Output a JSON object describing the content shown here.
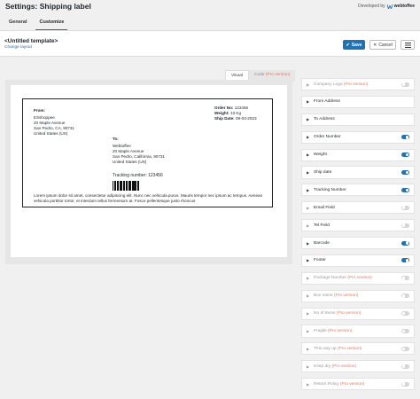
{
  "header": {
    "title": "Settings: Shipping label",
    "developed_by": "Developed by",
    "brand": "webtoffee"
  },
  "tabs": [
    {
      "label": "General",
      "active": false
    },
    {
      "label": "Customize",
      "active": true
    }
  ],
  "template": {
    "name": "<Untitled template>",
    "change_layout": "Change layout"
  },
  "actions": {
    "save": "Save",
    "cancel": "Cancel"
  },
  "view_tabs": {
    "visual": "Visual",
    "code": "Code",
    "code_pro": "(Pro version)"
  },
  "label": {
    "from_heading": "From:",
    "from_lines": [
      "ESshoppee",
      "20 Maple Avenue",
      "San Pedro, CA, 90731",
      "United States (US)"
    ],
    "order_number_label": "Order No:",
    "order_number": "123456",
    "weight_label": "Weight:",
    "weight": "10 Kg",
    "ship_date_label": "Ship Date:",
    "ship_date": "09-03-2023",
    "to_heading": "To:",
    "to_lines": [
      "Webtoffee",
      "20 Maple Avenue",
      "San Pedro, California, 90731",
      "United States (US)"
    ],
    "tracking": "Tracking number: 123456",
    "footer_text": "Lorem ipsum dolor sit amet, consectetur adipiscing elit. Nunc nec vehicula purus. Mauris tempor nec ipsum ac tempus. Aenean vehicula porttitor tortor, et interdum tellus fermentum at. Fusce pellentesque justo rhoncus"
  },
  "sidebar": {
    "items": [
      {
        "label": "Company Logo",
        "pro": "(Pro version)",
        "enabled": false,
        "is_pro": true
      },
      {
        "label": "From Address",
        "pro": "",
        "enabled": null,
        "is_pro": false
      },
      {
        "label": "To Address",
        "pro": "",
        "enabled": null,
        "is_pro": false
      },
      {
        "label": "Order Number",
        "pro": "",
        "enabled": true,
        "is_pro": false
      },
      {
        "label": "Weight",
        "pro": "",
        "enabled": true,
        "is_pro": false
      },
      {
        "label": "Ship date",
        "pro": "",
        "enabled": true,
        "is_pro": false
      },
      {
        "label": "Tracking Number",
        "pro": "",
        "enabled": true,
        "is_pro": false
      },
      {
        "label": "Email Field",
        "pro": "",
        "enabled": false,
        "is_pro": false
      },
      {
        "label": "Tel Field",
        "pro": "",
        "enabled": false,
        "is_pro": false
      },
      {
        "label": "Barcode",
        "pro": "",
        "enabled": true,
        "is_pro": false
      },
      {
        "label": "Footer",
        "pro": "",
        "enabled": true,
        "is_pro": false
      },
      {
        "label": "Package Number",
        "pro": "(Pro version)",
        "enabled": false,
        "is_pro": true
      },
      {
        "label": "Box name",
        "pro": "(Pro version)",
        "enabled": false,
        "is_pro": true
      },
      {
        "label": "No of Items",
        "pro": "(Pro version)",
        "enabled": false,
        "is_pro": true
      },
      {
        "label": "Fragile",
        "pro": "(Pro version)",
        "enabled": false,
        "is_pro": true
      },
      {
        "label": "This way up",
        "pro": "(Pro version)",
        "enabled": false,
        "is_pro": true
      },
      {
        "label": "Keep dry",
        "pro": "(Pro version)",
        "enabled": false,
        "is_pro": true
      },
      {
        "label": "Return Policy",
        "pro": "(Pro version)",
        "enabled": false,
        "is_pro": true
      }
    ]
  },
  "colors": {
    "accent": "#2271b1",
    "pro": "#e07a5f"
  }
}
